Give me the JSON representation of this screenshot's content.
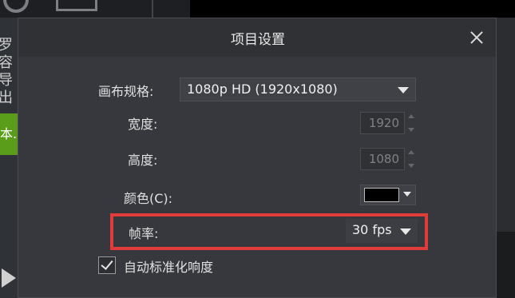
{
  "background": {
    "left_text": "罗容导出",
    "green_button_label": "本..."
  },
  "dialog": {
    "title": "项目设置",
    "canvas_label": "画布规格:",
    "canvas_value": "1080p HD (1920x1080)",
    "width_label": "宽度:",
    "width_value": "1920",
    "height_label": "高度:",
    "height_value": "1080",
    "color_label": "颜色(C):",
    "color_value": "#000000",
    "fps_label": "帧率:",
    "fps_value": "30 fps",
    "auto_normalize_label": "自动标准化响度",
    "auto_normalize_checked": true
  },
  "colors": {
    "highlight": "#e23b3b",
    "accent_green": "#5a9d1b"
  }
}
